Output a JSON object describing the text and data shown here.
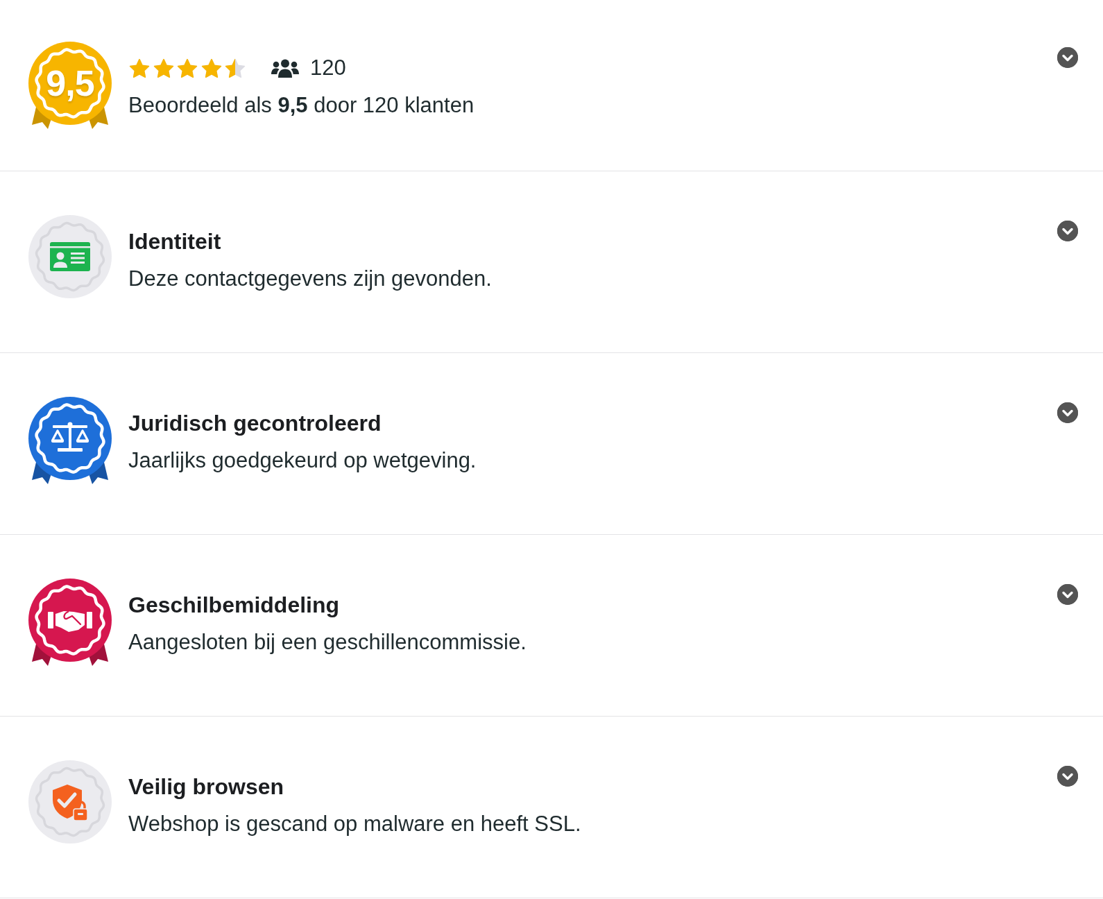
{
  "rating": {
    "score": "9,5",
    "stars": 4.5,
    "count": "120",
    "summary": "Beoordeeld als **9,5** door 120 klanten",
    "expanded": false
  },
  "checks": [
    {
      "kind": "idcard",
      "title": "Identiteit",
      "description": "Deze contactgegevens zijn gevonden.",
      "color": "#ebebef",
      "ribbon": false,
      "expanded": false
    },
    {
      "kind": "scales",
      "title": "Juridisch gecontroleerd",
      "description": "Jaarlijks goedgekeurd op wetgeving.",
      "color": "#1e6fd9",
      "ribbon": true,
      "expanded": false
    },
    {
      "kind": "handshake",
      "title": "Geschilbemiddeling",
      "description": "Aangesloten bij een geschillencommissie.",
      "color": "#d6174f",
      "ribbon": true,
      "expanded": false
    },
    {
      "kind": "shield",
      "title": "Veilig browsen",
      "description": "Webshop is gescand op malware en heeft SSL.",
      "color": "#ebebef",
      "ribbon": false,
      "expanded": false
    }
  ]
}
